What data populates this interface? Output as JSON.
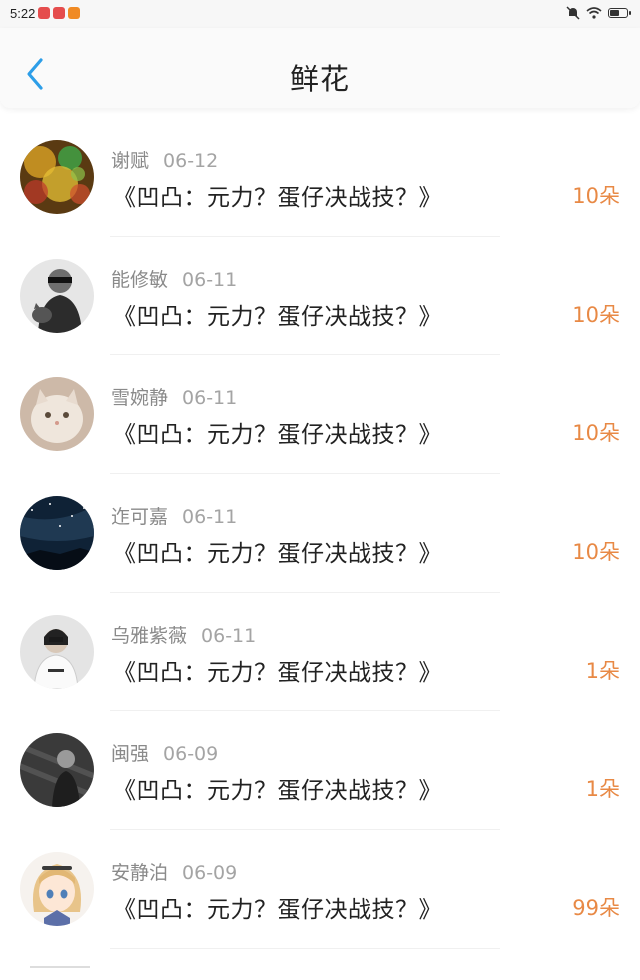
{
  "status": {
    "time": "5:22",
    "app_badges": [
      "#e54d4d",
      "#e54d4d",
      "#f08a24"
    ]
  },
  "header": {
    "title": "鲜花"
  },
  "colors": {
    "accent": "#2d9ee8",
    "flower_count": "#e88945"
  },
  "rows": [
    {
      "name": "谢赋",
      "date": "06-12",
      "book": "《凹凸：元力？蛋仔决战技？》",
      "count": "10朵",
      "avatar": "colorful-bokeh-avatar"
    },
    {
      "name": "能修敏",
      "date": "06-11",
      "book": "《凹凸：元力？蛋仔决战技？》",
      "count": "10朵",
      "avatar": "bw-person-with-cat-avatar"
    },
    {
      "name": "雪婉静",
      "date": "06-11",
      "book": "《凹凸：元力？蛋仔决战技？》",
      "count": "10朵",
      "avatar": "fluffy-cat-avatar"
    },
    {
      "name": "迮可嘉",
      "date": "06-11",
      "book": "《凹凸：元力？蛋仔决战技？》",
      "count": "10朵",
      "avatar": "starry-night-avatar"
    },
    {
      "name": "乌雅紫薇",
      "date": "06-11",
      "book": "《凹凸：元力？蛋仔决战技？》",
      "count": "1朵",
      "avatar": "girl-in-white-hoodie-avatar"
    },
    {
      "name": "闽强",
      "date": "06-09",
      "book": "《凹凸：元力？蛋仔决战技？》",
      "count": "1朵",
      "avatar": "bw-woman-avatar"
    },
    {
      "name": "安静泊",
      "date": "06-09",
      "book": "《凹凸：元力？蛋仔决战技？》",
      "count": "99朵",
      "avatar": "anime-girl-avatar"
    }
  ]
}
